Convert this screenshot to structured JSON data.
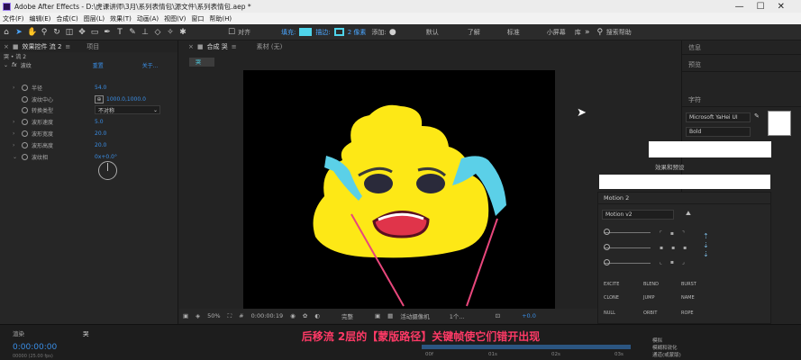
{
  "window": {
    "title": "Adobe After Effects - D:\\虎课讲师\\3月\\系列表情包\\源文件\\系列表情包.aep *"
  },
  "menu": [
    "文件(F)",
    "编辑(E)",
    "合成(C)",
    "图层(L)",
    "效果(T)",
    "动画(A)",
    "视图(V)",
    "窗口",
    "帮助(H)"
  ],
  "toolbar": {
    "align": "对齐",
    "fill": "填充:",
    "stroke": "描边:",
    "stroke_px": "2 像素",
    "add": "添加:",
    "workspaces": [
      "默认",
      "了解",
      "标准",
      "小屏幕",
      "库"
    ],
    "search": "搜索帮助"
  },
  "left": {
    "tabs": [
      "效果控件 流 2",
      "项目"
    ],
    "layer_path": "哭 • 流 2",
    "effect": {
      "name": "波纹",
      "reset": "重置",
      "about": "关于..."
    },
    "props": [
      {
        "name": "半径",
        "value": "54.0"
      },
      {
        "name": "波纹中心",
        "value": "1000.0,1000.0"
      },
      {
        "name": "转换类型",
        "value": "不对称"
      },
      {
        "name": "波形速度",
        "value": "5.0"
      },
      {
        "name": "波形宽度",
        "value": "20.0"
      },
      {
        "name": "波形高度",
        "value": "20.0"
      },
      {
        "name": "波纹相",
        "value": "0x+0.0°"
      }
    ]
  },
  "comp": {
    "tab": "合成 哭",
    "footage": "素材 (无)",
    "tag": "哭"
  },
  "viewer": {
    "zoom": "50%",
    "time": "0:00:00:19",
    "quality": "完整",
    "camera": "活动摄像机",
    "views": "1个...",
    "exposure": "+0.0"
  },
  "right": {
    "sections": [
      "信息",
      "预览",
      "字符"
    ],
    "font": "Microsoft YaHei UI",
    "weight": "Bold",
    "effects": "效果和预设",
    "motion": {
      "title": "Motion 2",
      "version": "Motion v2",
      "buttons": [
        "EXCITE",
        "BLEND",
        "BURST",
        "CLONE",
        "JUMP",
        "NAME",
        "NULL",
        "ORBIT",
        "ROPE",
        "WARP",
        "SPIN",
        "STARE"
      ]
    },
    "list": [
      "模拟",
      "模糊和锐化",
      "通道(或蒙版)"
    ]
  },
  "timeline": {
    "tabs": [
      "渲染",
      "哭"
    ],
    "timecode": "0:00:00:00",
    "fps": "00000 (25.00 fps)",
    "ticks": [
      "00f",
      "01s",
      "02s",
      "03s"
    ]
  },
  "subtitle": "后移流 2层的【蒙版路径】关键帧使它们错开出现",
  "colors": {
    "accent": "#4fd4ea",
    "poo": "#fde816",
    "tear": "#5bd0e8",
    "arrow": "#e8477c"
  }
}
